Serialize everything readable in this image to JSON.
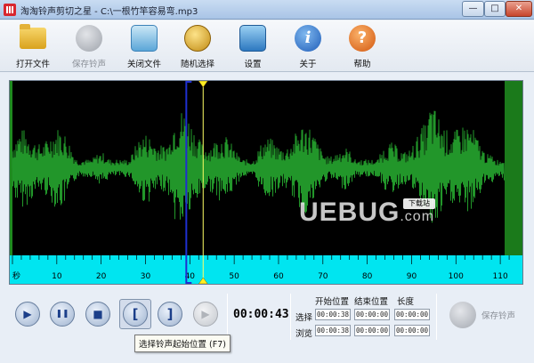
{
  "window": {
    "title": "淘淘铃声剪切之星 - C:\\一根竹竿容易弯.mp3",
    "minimize_glyph": "—",
    "maximize_glyph": "□",
    "close_glyph": "✕"
  },
  "toolbar": {
    "items": [
      {
        "label": "打开文件",
        "icon": "folder-icon",
        "enabled": true
      },
      {
        "label": "保存铃声",
        "icon": "save-ringtone-icon",
        "enabled": false
      },
      {
        "label": "关闭文件",
        "icon": "close-file-icon",
        "enabled": true
      },
      {
        "label": "随机选择",
        "icon": "random-select-icon",
        "enabled": true
      },
      {
        "label": "设置",
        "icon": "settings-icon",
        "enabled": true
      },
      {
        "label": "关于",
        "icon": "about-icon",
        "glyph": "i",
        "enabled": true
      },
      {
        "label": "帮助",
        "icon": "help-icon",
        "glyph": "?",
        "enabled": true
      }
    ]
  },
  "waveform": {
    "colors": {
      "background": "#000000",
      "wave": "#1f8a1f",
      "ruler": "#00e5f0",
      "selection_marker": "#1f2fd0",
      "playhead": "#ffff66"
    },
    "ruler": {
      "unit_label": "秒",
      "ticks": [
        "10",
        "20",
        "30",
        "40",
        "50",
        "60",
        "70",
        "80",
        "90",
        "100",
        "110"
      ]
    },
    "selection_start_sec": 39.2,
    "playhead_sec": 43,
    "max_sec": 112
  },
  "watermark": {
    "main": "UEBUG",
    "suffix": ".com",
    "badge": "下载站"
  },
  "transport": {
    "play_glyph": "▶",
    "pause_glyph": "❚❚",
    "stop_glyph": "■",
    "mark_start_glyph": "[",
    "mark_end_glyph": "]",
    "play_selection_glyph": "▶",
    "current_time": "00:00:43"
  },
  "positions": {
    "headers": {
      "start": "开始位置",
      "end": "结束位置",
      "length": "长度"
    },
    "rows": [
      {
        "label": "选择",
        "start": "00:00:38",
        "end": "00:00:00",
        "length": "00:00:00"
      },
      {
        "label": "浏览",
        "start": "00:00:38",
        "end": "00:00:00",
        "length": "00:00:00"
      }
    ]
  },
  "save_ringtone": {
    "label": "保存铃声",
    "enabled": false
  },
  "tooltip": {
    "text": "选择铃声起始位置 (F7)"
  }
}
